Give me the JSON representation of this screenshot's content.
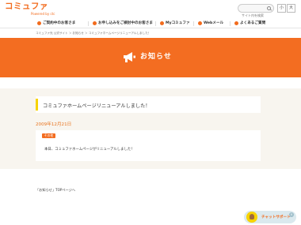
{
  "header": {
    "logo_text": "コミュファ",
    "logo_sub": "Powered by ctc",
    "search_placeholder": "サイト内を検索",
    "font_small": "小",
    "font_large": "大"
  },
  "nav": {
    "items": [
      {
        "label": "ご契約中のお客さま"
      },
      {
        "label": "お申し込みをご検討中のお客さま"
      },
      {
        "label": "Myコミュファ"
      },
      {
        "label": "Webメール"
      },
      {
        "label": "よくあるご質問"
      }
    ]
  },
  "breadcrumb": "コミュファ光 公式サイト ＞ お知らせ ＞ コミュファホームページリニューアルしました！",
  "banner": {
    "title": "お知らせ"
  },
  "article": {
    "title": "コミュファホームページリニューアルしました！",
    "date": "2009年12月21日",
    "category": "その他",
    "body": "本日、コミュファホームページがリニューアルしました！"
  },
  "footer": {
    "back_link": "「お知らせ」TOPページへ"
  },
  "chat": {
    "label": "チャットサポート",
    "close": "×"
  },
  "colors": {
    "accent": "#f36d21",
    "title_bar": "#f7d300",
    "date": "#e8741f",
    "background": "#f8f5ef"
  }
}
